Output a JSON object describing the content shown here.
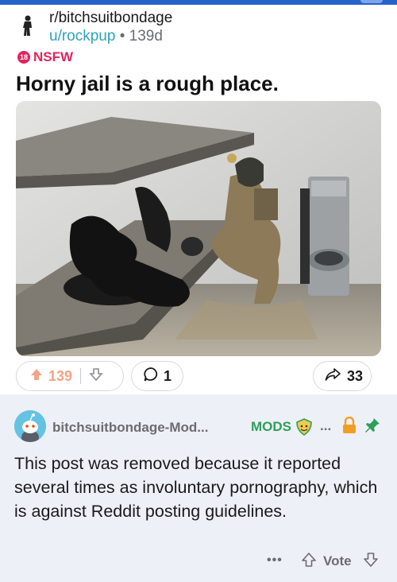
{
  "post": {
    "subreddit": "r/bitchsuitbondage",
    "author": "u/rockpup",
    "separator": " • ",
    "age": "139d",
    "nsfw_badge": "18",
    "nsfw_label": "NSFW",
    "title": "Horny jail is a rough place.",
    "score": "139",
    "comments": "1",
    "shares": "33"
  },
  "mod_comment": {
    "author": "bitchsuitbondage-Mod...",
    "flair": "MODS",
    "more": "...",
    "text": "This post was removed because it reported several times as involuntary pornography, which is against Reddit posting guidelines.",
    "footer_more": "•••",
    "vote_label": "Vote"
  },
  "colors": {
    "accent_blue": "#2563c9",
    "username_teal": "#2ea4b8",
    "nsfw_pink": "#e0245e",
    "upvote_orange": "#f4a389",
    "mods_green": "#2ea05a",
    "lock_orange": "#f0a020",
    "mod_bg": "#eef0f8"
  }
}
